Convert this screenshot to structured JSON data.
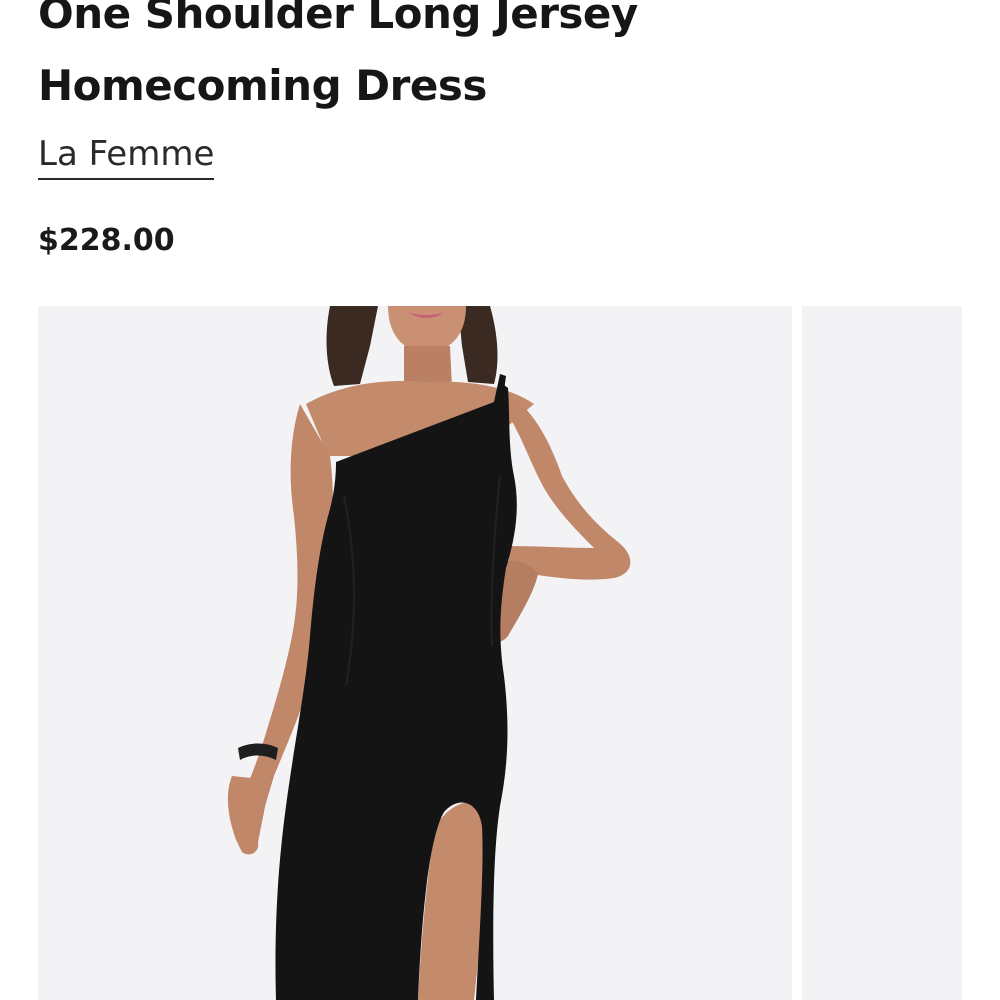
{
  "product": {
    "title_line1": "One Shoulder Long Jersey",
    "title_line2": "Homecoming Dress",
    "brand": "La Femme",
    "price": "$228.00"
  },
  "gallery": {
    "images": [
      {
        "alt": "One Shoulder Long Jersey Homecoming Dress"
      },
      {
        "alt": ""
      }
    ]
  },
  "colors": {
    "image_background": "#f3f3f5",
    "dress": "#141414",
    "text": "#1a1a1a"
  }
}
